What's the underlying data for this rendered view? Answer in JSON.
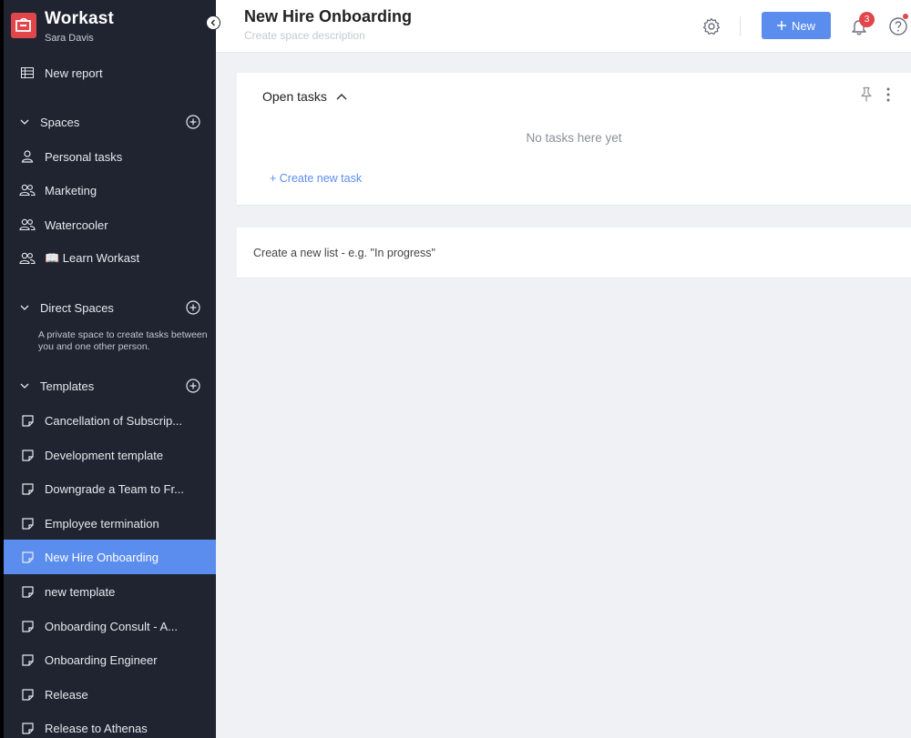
{
  "brand": {
    "name": "Workast",
    "user": "Sara Davis"
  },
  "sidebar": {
    "new_report": "New report",
    "spaces": {
      "label": "Spaces",
      "items": [
        "Personal tasks",
        "Marketing",
        "Watercooler",
        "📖 Learn Workast"
      ]
    },
    "direct_spaces": {
      "label": "Direct Spaces",
      "note": "A private space to create tasks between you and one other person."
    },
    "templates": {
      "label": "Templates",
      "items": [
        "Cancellation of Subscrip...",
        "Development template",
        "Downgrade a Team to Fr...",
        "Employee termination",
        "New Hire Onboarding",
        "new template",
        "Onboarding Consult - A...",
        "Onboarding Engineer",
        "Release",
        "Release to Athenas"
      ],
      "active_index": 4
    }
  },
  "header": {
    "title": "New Hire Onboarding",
    "description_placeholder": "Create space description",
    "new_label": "New",
    "notification_count": "3"
  },
  "main": {
    "list_title": "Open tasks",
    "empty_text": "No tasks here yet",
    "create_task": "+ Create new task",
    "create_list_placeholder": "Create a new list - e.g. \"In progress\""
  },
  "colors": {
    "accent": "#5b8def",
    "sidebar_bg": "#1f2430",
    "badge": "#e0464a"
  }
}
